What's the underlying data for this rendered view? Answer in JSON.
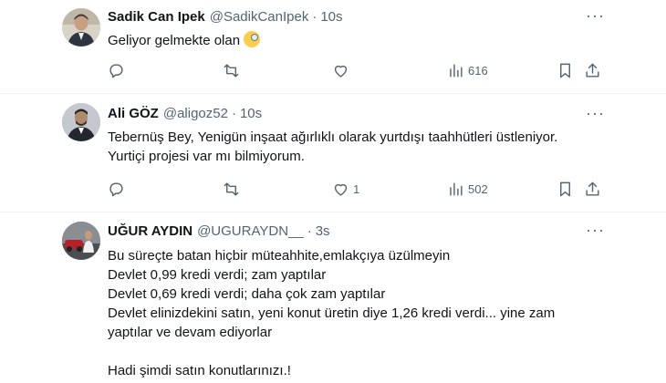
{
  "tweets": [
    {
      "name": "Sadik Can Ipek",
      "handle": "@SadikCanIpek",
      "time": "10s",
      "text": "Geliyor gelmekte olan",
      "reply_count": "",
      "retweet_count": "",
      "like_count": "",
      "views": "616"
    },
    {
      "name": "Ali GÖZ",
      "handle": "@aligoz52",
      "time": "10s",
      "text": "Tebernüş Bey, Yenigün inşaat ağırlıklı olarak yurtdışı taahhütleri üstleniyor.\nYurtiçi projesi var mı bilmiyorum.",
      "reply_count": "",
      "retweet_count": "",
      "like_count": "1",
      "views": "502"
    },
    {
      "name": "UĞUR AYDIN",
      "handle": "@UGURAYDN__",
      "time": "3s",
      "text": "Bu süreçte batan hiçbir müteahhite,emlakçıya üzülmeyin\nDevlet 0,99 kredi verdi; zam yaptılar\nDevlet 0,69 kredi verdi; daha çok zam yaptılar\nDevlet elinizdekini satın, yeni konut üretin diye 1,26 kredi verdi... yine zam\nyaptılar ve devam ediyorlar\n\nHadi şimdi satın konutlarınızı.!"
    }
  ],
  "icons": {
    "more": "more-dots-icon",
    "reply": "reply-icon",
    "retweet": "retweet-icon",
    "like": "heart-icon",
    "views": "views-chart-icon",
    "bookmark": "bookmark-icon",
    "share": "share-icon",
    "emoji": "monocle-face-emoji"
  },
  "colors": {
    "text": "#0f1419",
    "secondary": "#536471",
    "divider": "#eff3f4"
  }
}
